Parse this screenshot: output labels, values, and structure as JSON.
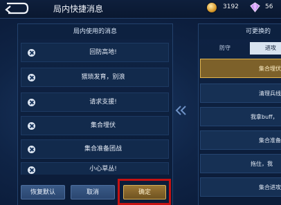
{
  "header": {
    "title": "局内快捷消息",
    "coins": "3192",
    "gems": "56"
  },
  "left": {
    "title": "局内使用的消息",
    "items": [
      {
        "label": "回防高地!"
      },
      {
        "label": "猥琐发育，别浪"
      },
      {
        "label": "请求支援!"
      },
      {
        "label": "集合埋伏"
      },
      {
        "label": "集合准备团战"
      },
      {
        "label": "小心草丛!"
      }
    ]
  },
  "right": {
    "title": "可更换的",
    "tabs": [
      {
        "label": "防守"
      },
      {
        "label": "进攻"
      }
    ],
    "items": [
      {
        "label": "集合埋伏"
      },
      {
        "label": "清理兵线"
      },
      {
        "label": "我拿buff，"
      },
      {
        "label": "集合准备"
      },
      {
        "label": "拖住，我"
      },
      {
        "label": "集合进攻"
      }
    ]
  },
  "buttons": {
    "reset": "恢复默认",
    "cancel": "取消",
    "confirm": "确定"
  },
  "icons": {
    "back": "back-arrow-icon",
    "coin": "gold-coin-icon",
    "gem": "diamond-icon",
    "collapse": "double-chevron-left-icon"
  },
  "colors": {
    "accent": "#e2b54d",
    "highlight": "#c61212"
  }
}
